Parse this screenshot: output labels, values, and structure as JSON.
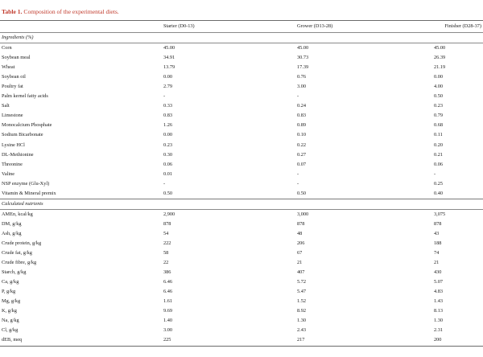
{
  "caption": {
    "label": "Table 1.",
    "text": "Composition of the experimental diets."
  },
  "headers": [
    "",
    "Starter (D0-13)",
    "Grower (D13-28)",
    "Finisher (D28-37)"
  ],
  "sections": [
    {
      "title": "Ingredients (%)",
      "rows": [
        [
          "Corn",
          "45.00",
          "45.00",
          "45.00"
        ],
        [
          "Soybean meal",
          "34.91",
          "30.73",
          "26.39"
        ],
        [
          "Wheat",
          "13.79",
          "17.39",
          "21.19"
        ],
        [
          "Soybean oil",
          "0.00",
          "0.76",
          "0.00"
        ],
        [
          "Poultry fat",
          "2.79",
          "3.00",
          "4.00"
        ],
        [
          "Palm kernel fatty acids",
          "-",
          "-",
          "0.50"
        ],
        [
          "Salt",
          "0.33",
          "0.24",
          "0.23"
        ],
        [
          "Limestone",
          "0.83",
          "0.83",
          "0.79"
        ],
        [
          "Monocalcium Phosphate",
          "1.26",
          "0.89",
          "0.68"
        ],
        [
          "Sodium Bicarbonate",
          "0.00",
          "0.10",
          "0.11"
        ],
        [
          "Lysine HCl",
          "0.23",
          "0.22",
          "0.20"
        ],
        [
          "DL-Methionine",
          "0.30",
          "0.27",
          "0.21"
        ],
        [
          "Threonine",
          "0.06",
          "0.07",
          "0.06"
        ],
        [
          "Valine",
          "0.01",
          "-",
          "-"
        ],
        [
          "NSP enzyme (Glu-Xyl)",
          "-",
          "-",
          "0.25"
        ],
        [
          "Vitamin & Mineral premix",
          "0.50",
          "0.50",
          "0.40"
        ]
      ]
    },
    {
      "title": "Calculated nutrients",
      "rows": [
        [
          "AMEn, kcal/kg",
          "2,900",
          "3,000",
          "3,075"
        ],
        [
          "DM, g/kg",
          "878",
          "878",
          "878"
        ],
        [
          "Ash, g/kg",
          "54",
          "48",
          "43"
        ],
        [
          "Crude protein, g/kg",
          "222",
          "206",
          "188"
        ],
        [
          "Crude fat, g/kg",
          "58",
          "67",
          "74"
        ],
        [
          "Crude fibre, g/kg",
          "22",
          "21",
          "21"
        ],
        [
          "Starch, g/kg",
          "386",
          "407",
          "430"
        ],
        [
          "Ca, g/kg",
          "6.46",
          "5.72",
          "5.07"
        ],
        [
          "P, g/kg",
          "6.46",
          "5.47",
          "4.83"
        ],
        [
          "Mg, g/kg",
          "1.61",
          "1.52",
          "1.43"
        ],
        [
          "K, g/kg",
          "9.69",
          "8.92",
          "8.13"
        ],
        [
          "Na, g/kg",
          "1.40",
          "1.30",
          "1.30"
        ],
        [
          "Cl, g/kg",
          "3.00",
          "2.43",
          "2.31"
        ],
        [
          "dEB, meq",
          "225",
          "217",
          "200"
        ]
      ]
    }
  ]
}
